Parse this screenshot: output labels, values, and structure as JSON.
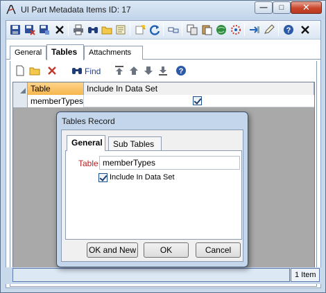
{
  "window": {
    "title": "UI Part Metadata Items ID: 17"
  },
  "window_controls": {
    "minimize": "—",
    "maximize": "□",
    "close": "✕"
  },
  "toolbar": {
    "icons": [
      "save-icon",
      "save-and-close-icon",
      "save-as-icon",
      "delete-icon",
      "print-icon",
      "find-icon",
      "open-folder-icon",
      "document-icon",
      "wizard-icon",
      "refresh-icon",
      "link-icon",
      "copy-icon",
      "paste-icon",
      "web-icon",
      "settings-icon",
      "export-icon",
      "edit-icon",
      "help-icon"
    ]
  },
  "tabs": [
    {
      "label": "General"
    },
    {
      "label": "Tables",
      "active": true
    },
    {
      "label": "Attachments"
    }
  ],
  "subtoolbar": {
    "find_label": "Find",
    "icons": [
      "new-icon",
      "open-icon",
      "delete-icon",
      "find-icon",
      "move-top-icon",
      "move-up-icon",
      "move-down-icon",
      "move-bottom-icon",
      "help-icon"
    ]
  },
  "grid": {
    "columns": [
      "Table",
      "Include In Data Set"
    ],
    "rows": [
      {
        "table": "memberTypes",
        "include_in_data_set": true
      }
    ]
  },
  "status": {
    "count_text": "1 Item"
  },
  "dialog": {
    "title": "Tables Record",
    "tabs": [
      {
        "label": "General",
        "active": true
      },
      {
        "label": "Sub Tables"
      }
    ],
    "table_label": "Table",
    "table_value": "memberTypes",
    "include_label": "Include In Data Set",
    "include_checked": true,
    "buttons": {
      "ok_and_new": "OK and New",
      "ok": "OK",
      "cancel": "Cancel"
    }
  }
}
